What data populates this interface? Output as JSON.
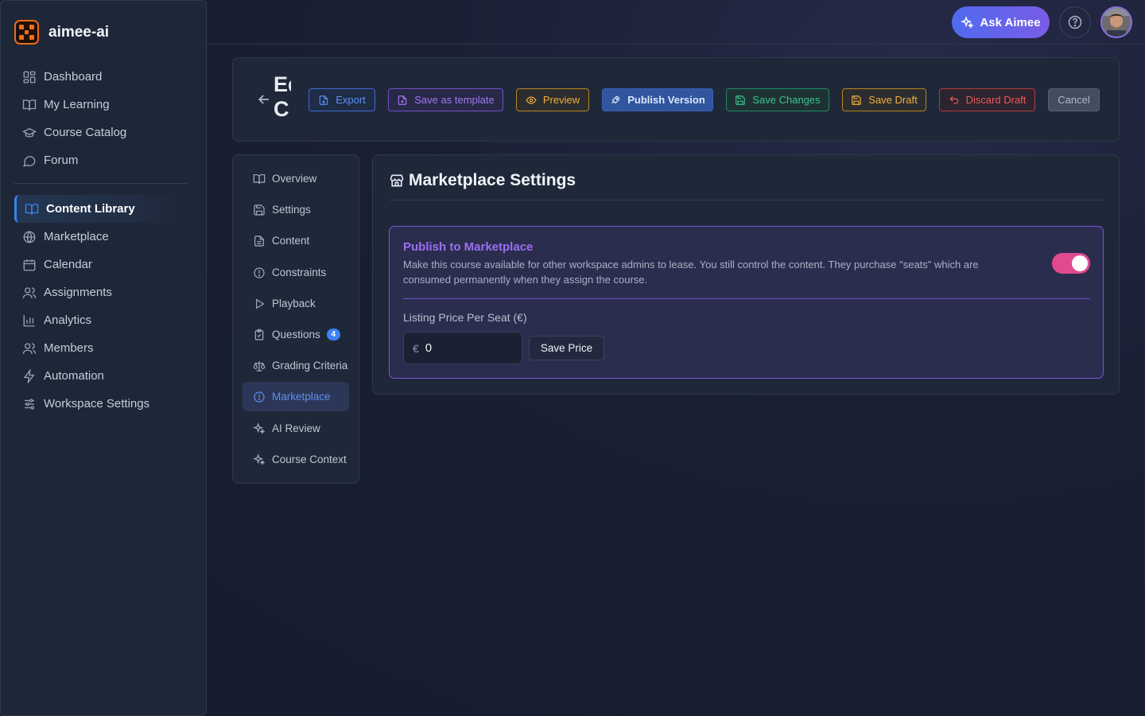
{
  "brand": {
    "name": "aimee-ai"
  },
  "sidebar": {
    "primary": [
      {
        "label": "Dashboard",
        "icon": "dashboard-icon"
      },
      {
        "label": "My Learning",
        "icon": "book-open-icon"
      },
      {
        "label": "Course Catalog",
        "icon": "graduation-cap-icon"
      },
      {
        "label": "Forum",
        "icon": "chat-bubble-icon"
      }
    ],
    "secondary": [
      {
        "label": "Content Library",
        "icon": "book-open-icon",
        "active": true
      },
      {
        "label": "Marketplace",
        "icon": "globe-icon"
      },
      {
        "label": "Calendar",
        "icon": "calendar-icon"
      },
      {
        "label": "Assignments",
        "icon": "users-icon"
      },
      {
        "label": "Analytics",
        "icon": "bar-chart-icon"
      },
      {
        "label": "Members",
        "icon": "users-icon"
      },
      {
        "label": "Automation",
        "icon": "lightning-icon"
      },
      {
        "label": "Workspace Settings",
        "icon": "sliders-icon"
      }
    ]
  },
  "topbar": {
    "ask_label": "Ask Aimee"
  },
  "header": {
    "title_lines": [
      "Ed",
      "C"
    ],
    "buttons": {
      "export": "Export",
      "save_template": "Save as template",
      "preview": "Preview",
      "publish": "Publish Version",
      "save_changes": "Save Changes",
      "save_draft": "Save Draft",
      "discard_draft": "Discard Draft",
      "cancel": "Cancel"
    }
  },
  "tabs": [
    {
      "label": "Overview",
      "icon": "book-open-icon"
    },
    {
      "label": "Settings",
      "icon": "save-disk-icon"
    },
    {
      "label": "Content",
      "icon": "document-icon"
    },
    {
      "label": "Constraints",
      "icon": "alert-circle-icon"
    },
    {
      "label": "Playback",
      "icon": "play-icon"
    },
    {
      "label": "Questions",
      "icon": "clipboard-check-icon",
      "badge": "4"
    },
    {
      "label": "Grading Criteria",
      "icon": "scale-icon"
    },
    {
      "label": "Marketplace",
      "icon": "alert-circle-icon",
      "active": true
    },
    {
      "label": "AI Review",
      "icon": "sparkles-icon"
    },
    {
      "label": "Course Context",
      "icon": "sparkles-icon"
    }
  ],
  "marketplace": {
    "title": "Marketplace Settings",
    "publish_title": "Publish to Marketplace",
    "publish_desc": "Make this course available for other workspace admins to lease. You still control the content. They purchase \"seats\" which are consumed permanently when they assign the course.",
    "publish_enabled": true,
    "price_label": "Listing Price Per Seat (€)",
    "currency_symbol": "€",
    "price_value": "0",
    "save_price_label": "Save Price"
  },
  "colors": {
    "accent": "#3b82f6",
    "toggle_on": "#e14a8e",
    "marketplace_purple": "#9b6ff0"
  }
}
